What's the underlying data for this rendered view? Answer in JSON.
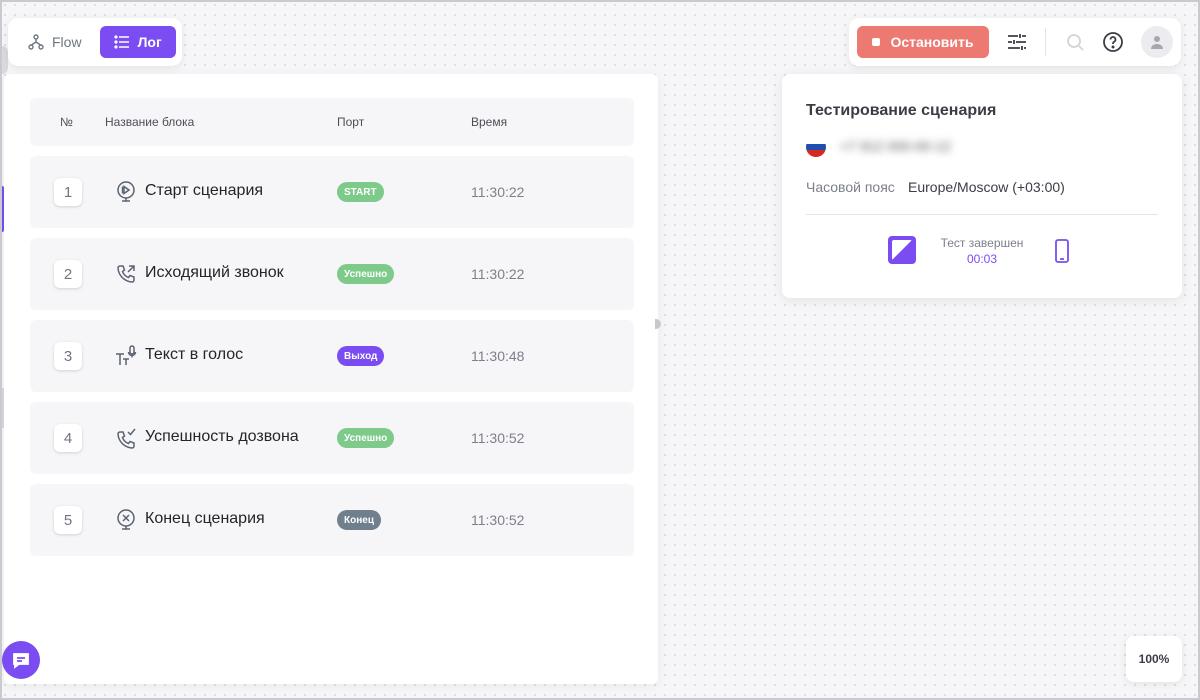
{
  "view_switch": {
    "flow_label": "Flow",
    "log_label": "Лог",
    "active": "Лог"
  },
  "log_table": {
    "headers": {
      "num": "№",
      "name": "Название блока",
      "port": "Порт",
      "time": "Время"
    },
    "rows": [
      {
        "num": "1",
        "name": "Старт сценария",
        "icon": "play-circle-icon",
        "port": "START",
        "port_color": "#7dca8a",
        "time": "11:30:22"
      },
      {
        "num": "2",
        "name": "Исходящий звонок",
        "icon": "outgoing-call-icon",
        "port": "Успешно",
        "port_color": "#7dca8a",
        "time": "11:30:22"
      },
      {
        "num": "3",
        "name": "Текст в голос",
        "icon": "text-to-speech-icon",
        "port": "Выход",
        "port_color": "#7a4cf2",
        "time": "11:30:48"
      },
      {
        "num": "4",
        "name": "Успешность дозвона",
        "icon": "call-check-icon",
        "port": "Успешно",
        "port_color": "#7dca8a",
        "time": "11:30:52"
      },
      {
        "num": "5",
        "name": "Конец сценария",
        "icon": "stop-circle-icon",
        "port": "Конец",
        "port_color": "#6f7f8c",
        "time": "11:30:52"
      }
    ]
  },
  "toolbar": {
    "stop_label": "Остановить",
    "stop_color": "#ec7a72",
    "icons": [
      "sliders-icon",
      "search-icon",
      "help-icon",
      "avatar-icon"
    ]
  },
  "test_card": {
    "title": "Тестирование сценария",
    "phone": "+7 912 000-00-12",
    "timezone_label": "Часовой пояс",
    "timezone_value": "Europe/Moscow (+03:00)",
    "status_text": "Тест завершен",
    "status_time": "00:03"
  },
  "zoom": {
    "value": "100%"
  },
  "colors": {
    "accent": "#7a4cf2",
    "success": "#7dca8a",
    "neutral": "#6f7f8c",
    "danger": "#ec7a72"
  }
}
